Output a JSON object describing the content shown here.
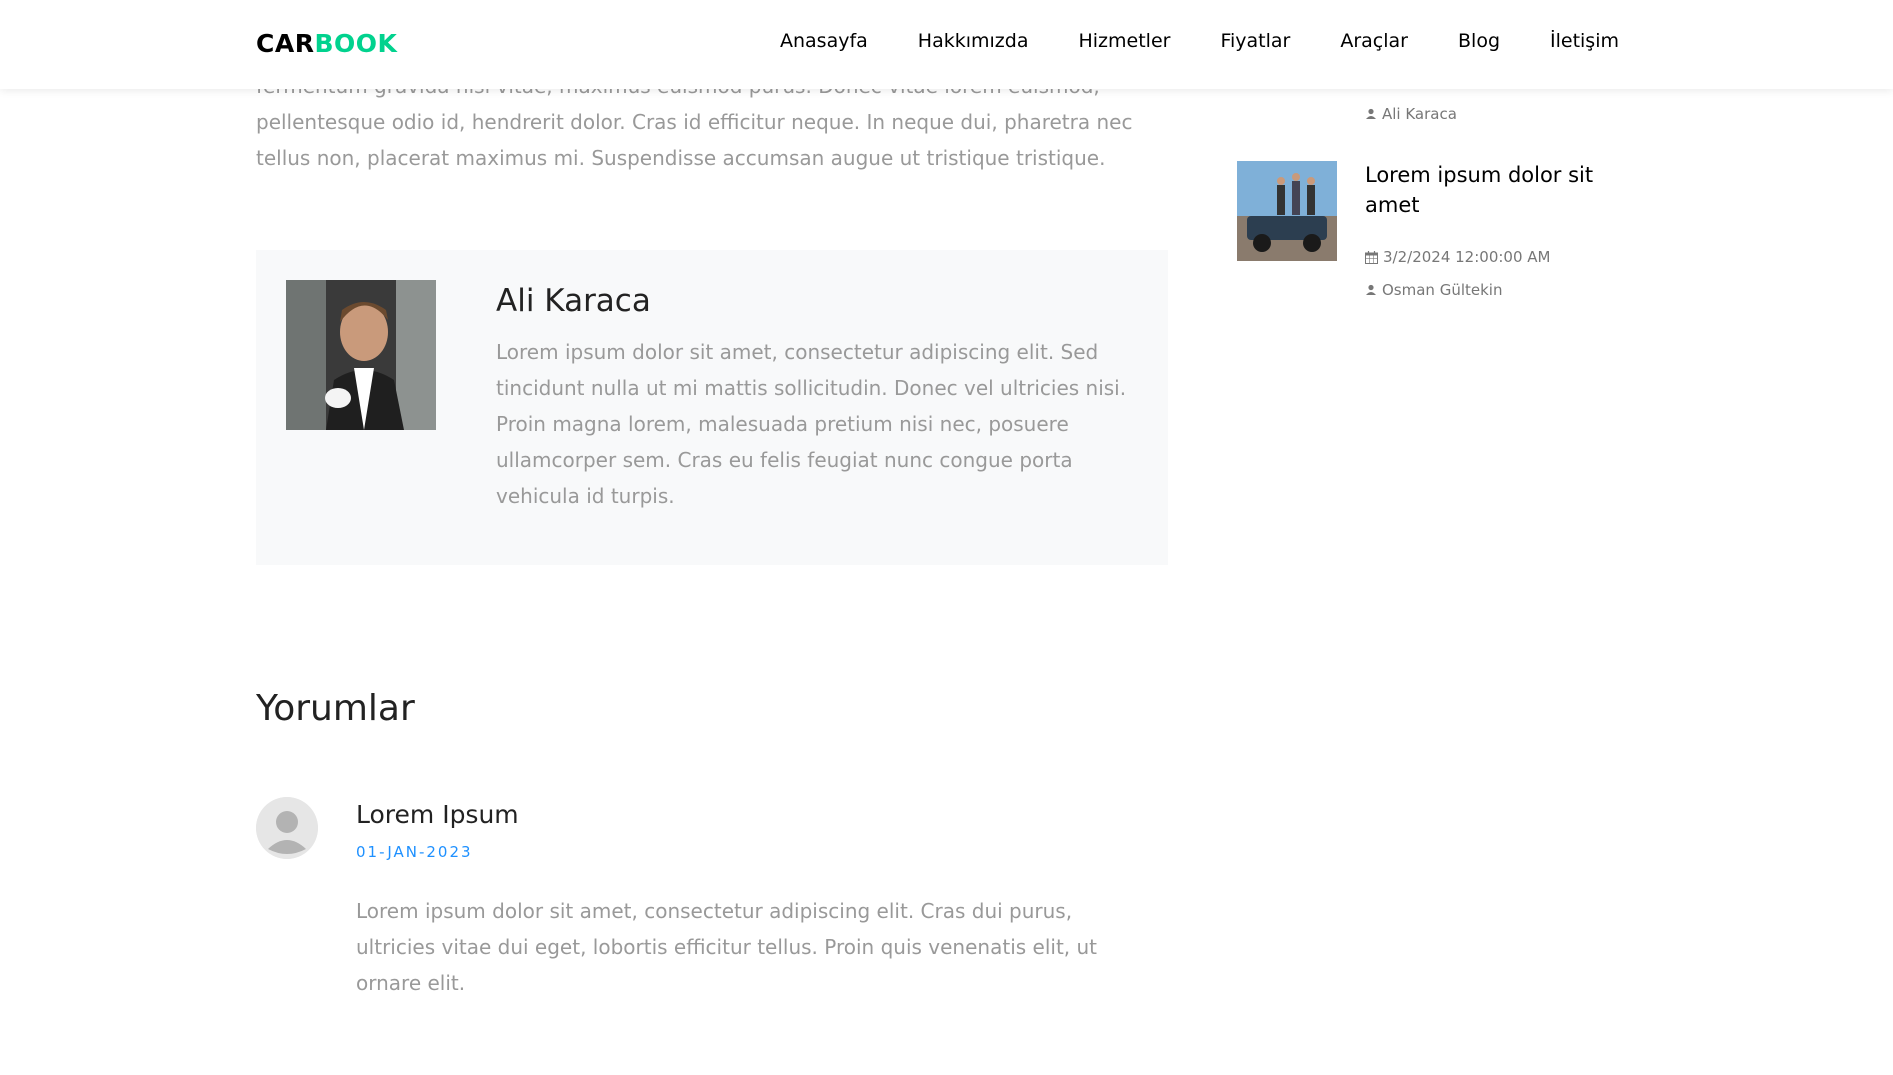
{
  "nav": {
    "brand_main": "CAR",
    "brand_accent": "BOOK",
    "items": [
      "Anasayfa",
      "Hakkımızda",
      "Hizmetler",
      "Fiyatlar",
      "Araçlar",
      "Blog",
      "İletişim"
    ]
  },
  "article": {
    "intro_text": "fermentum gravida nisi vitae, maximus euismod purus. Donec vitae lorem euismod, pellentesque odio id, hendrerit dolor. Cras id efficitur neque. In neque dui, pharetra nec tellus non, placerat maximus mi. Suspendisse accumsan augue ut tristique tristique."
  },
  "author": {
    "name": "Ali Karaca",
    "bio": "Lorem ipsum dolor sit amet, consectetur adipiscing elit. Sed tincidunt nulla ut mi mattis sollicitudin. Donec vel ultricies nisi. Proin magna lorem, malesuada pretium nisi nec, posuere ullamcorper sem. Cras eu felis feugiat nunc congue porta vehicula id turpis."
  },
  "comments": {
    "title": "Yorumlar",
    "items": [
      {
        "name": "Lorem Ipsum",
        "date": "01-JAN-2023",
        "text": "Lorem ipsum dolor sit amet, consectetur adipiscing elit. Cras dui purus, ultricies vitae dui eget, lobortis efficitur tellus. Proin quis venenatis elit, ut ornare elit."
      }
    ]
  },
  "sidebar": {
    "posts": [
      {
        "author": "Ali Karaca"
      },
      {
        "title": "Lorem ipsum dolor sit amet",
        "date": "3/2/2024 12:00:00 AM",
        "author": "Osman Gültekin"
      }
    ]
  },
  "colors": {
    "brand_accent": "#01d28e",
    "date_accent": "#1e90ff"
  }
}
